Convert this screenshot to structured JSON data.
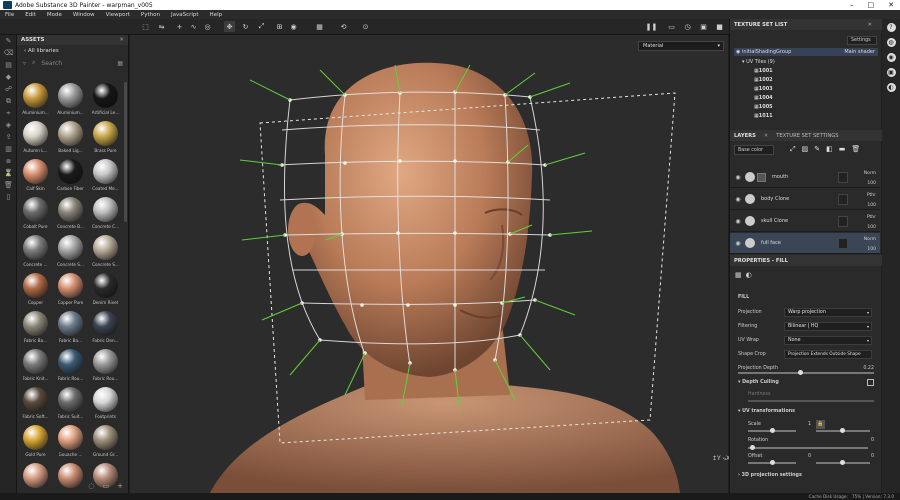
{
  "window": {
    "title": "Adobe Substance 3D Painter - warpman_v005",
    "min": "–",
    "max": "□",
    "close": "✕"
  },
  "menu": [
    "File",
    "Edit",
    "Mode",
    "Window",
    "Viewport",
    "Python",
    "JavaScript",
    "Help"
  ],
  "assets": {
    "title": "ASSETS",
    "close": "✕",
    "library": "All libraries",
    "search_placeholder": "Search",
    "materials": [
      {
        "label": "Aluminium...",
        "color": "#c99a3a"
      },
      {
        "label": "Aluminium...",
        "color": "#9a9a9a"
      },
      {
        "label": "Artificial Le...",
        "color": "#151515"
      },
      {
        "label": "Autumn L...",
        "color": "#d8d3c8"
      },
      {
        "label": "Baked Lig...",
        "color": "#b0a38e"
      },
      {
        "label": "Brass Pure",
        "color": "#c8a84a"
      },
      {
        "label": "Calf Skin",
        "color": "#d88f6e"
      },
      {
        "label": "Carbon Fiber",
        "color": "#1a1a1a"
      },
      {
        "label": "Coated Me...",
        "color": "#c8c8c8"
      },
      {
        "label": "Cobalt Pure",
        "color": "#6a6a6a"
      },
      {
        "label": "Concrete B...",
        "color": "#8a8478"
      },
      {
        "label": "Concrete C...",
        "color": "#bdbdbd"
      },
      {
        "label": "Concrete ...",
        "color": "#7c7c7c"
      },
      {
        "label": "Concrete S...",
        "color": "#a7a7a7"
      },
      {
        "label": "Concrete S...",
        "color": "#b7aa98"
      },
      {
        "label": "Copper",
        "color": "#b06a45"
      },
      {
        "label": "Copper Pure",
        "color": "#d48f6f"
      },
      {
        "label": "Denim Rivet",
        "color": "#2a2a2a"
      },
      {
        "label": "Fabric Ba...",
        "color": "#8c8677"
      },
      {
        "label": "Fabric Ba...",
        "color": "#6e7c8a"
      },
      {
        "label": "Fabric Den...",
        "color": "#3b4450"
      },
      {
        "label": "Fabric Knit...",
        "color": "#7a7a7a"
      },
      {
        "label": "Fabric Rou...",
        "color": "#3c5a72"
      },
      {
        "label": "Fabric Rou...",
        "color": "#9a9a9a"
      },
      {
        "label": "Fabric Soft...",
        "color": "#5a4a3c"
      },
      {
        "label": "Fabric Suit...",
        "color": "#6b6b6b"
      },
      {
        "label": "Footprints",
        "color": "#d6d6d6"
      },
      {
        "label": "Gold Pure",
        "color": "#d6a534"
      },
      {
        "label": "Gouache ...",
        "color": "#e0a27f"
      },
      {
        "label": "Ground Gr...",
        "color": "#9a8f7a"
      },
      {
        "label": "",
        "color": "#d49a80"
      },
      {
        "label": "",
        "color": "#c98c72"
      },
      {
        "label": "",
        "color": "#b58a78"
      }
    ]
  },
  "viewport": {
    "material_mode": "Material",
    "axis_label": "Y\n  X"
  },
  "texture_set_list": {
    "title": "TEXTURE SET LIST",
    "settings": "Settings",
    "group": "initialShadingGroup",
    "shader": "Main shader",
    "uv_tiles": "UV Tiles (9)",
    "tiles": [
      "1001",
      "1002",
      "1003",
      "1004",
      "1005",
      "1011"
    ]
  },
  "layers": {
    "tab_layers": "LAYERS",
    "tab_settings": "TEXTURE SET SETTINGS",
    "channel": "Base color",
    "items": [
      {
        "name": "mouth",
        "blend": "Norm",
        "opacity": "100"
      },
      {
        "name": "body Clone",
        "blend": "Pthr",
        "opacity": "100"
      },
      {
        "name": "skull Clone",
        "blend": "Pthr",
        "opacity": "100"
      },
      {
        "name": "full face",
        "blend": "Norm",
        "opacity": "100"
      }
    ]
  },
  "properties": {
    "title": "PROPERTIES - FILL",
    "section": "FILL",
    "projection_label": "Projection",
    "projection": "Warp projection",
    "filtering_label": "Filtering",
    "filtering": "Bilinear | HQ",
    "uvwrap_label": "UV Wrap",
    "uvwrap": "None",
    "shapecrop_label": "Shape Crop",
    "shapecrop": "Projection Extends Outside Shape",
    "depth_label": "Projection Depth",
    "depth_value": "0.22",
    "depth_culling": "Depth Culling",
    "hardness_label": "Hardness",
    "uv_transformations": "UV transformations",
    "scale_label": "Scale",
    "scale_value": "1",
    "rotation_label": "Rotation",
    "rotation_value": "0",
    "offset_label": "Offset",
    "offset_x": "0",
    "offset_y": "0",
    "projection3d": "3D projection settings"
  },
  "status": {
    "cache": "Cache Disk Usage:",
    "usage": "75% | Version: 7.3.0"
  }
}
